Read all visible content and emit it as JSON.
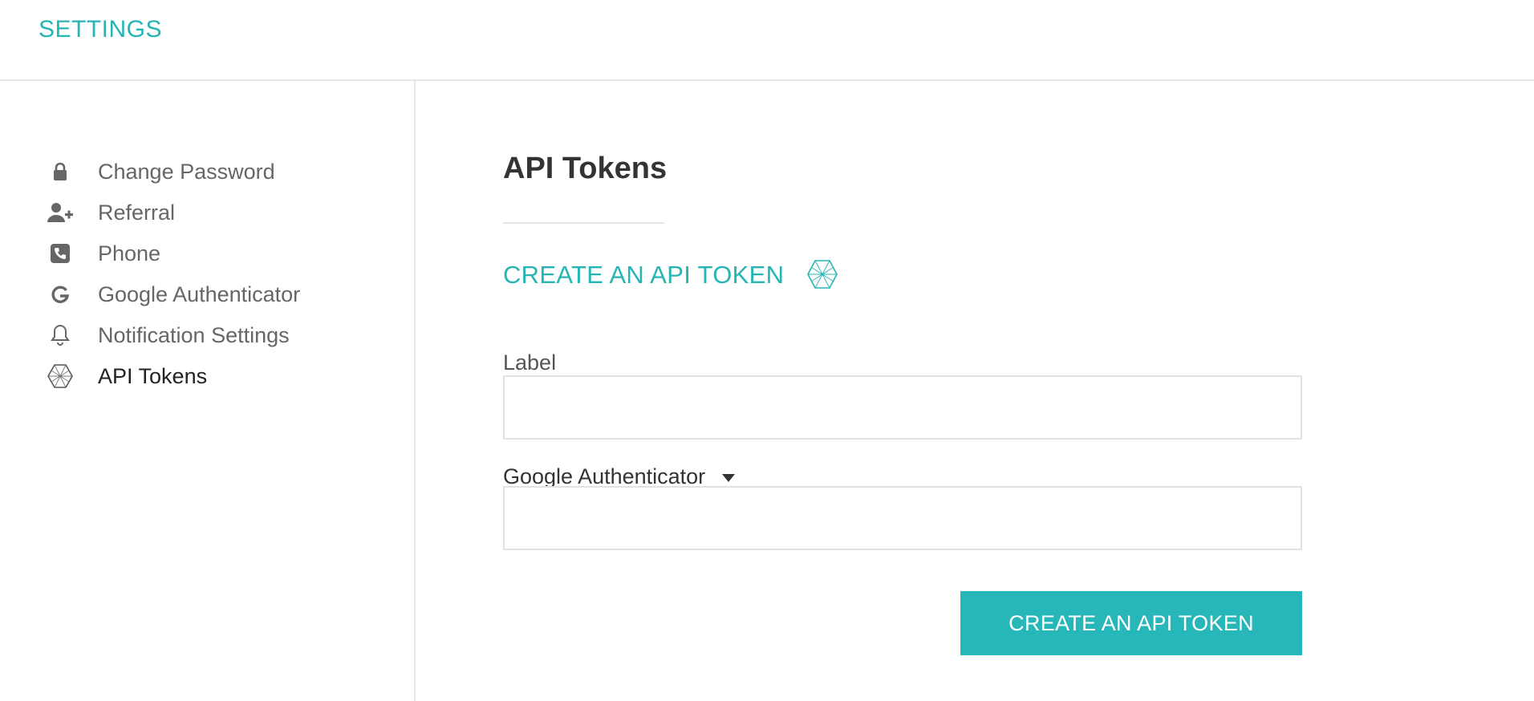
{
  "header": {
    "title": "SETTINGS"
  },
  "colors": {
    "accent": "#26b5b5",
    "button_bg": "#28b7b8",
    "divider": "#e6e6e6"
  },
  "sidebar": {
    "items": [
      {
        "label": "Change Password",
        "icon": "lock-icon"
      },
      {
        "label": "Referral",
        "icon": "user-plus-icon"
      },
      {
        "label": "Phone",
        "icon": "phone-icon"
      },
      {
        "label": "Google Authenticator",
        "icon": "google-icon"
      },
      {
        "label": "Notification Settings",
        "icon": "bell-icon"
      },
      {
        "label": "API Tokens",
        "icon": "api-token-icon",
        "active": true
      }
    ]
  },
  "main": {
    "page_title": "API Tokens",
    "section_title": "CREATE AN API TOKEN",
    "section_icon": "api-token-icon",
    "form": {
      "label_field": {
        "label": "Label",
        "value": "",
        "placeholder": ""
      },
      "auth_field": {
        "label": "Google Authenticator",
        "icon": "caret-down-icon",
        "value": "",
        "placeholder": ""
      },
      "submit_label": "CREATE AN API TOKEN"
    }
  }
}
